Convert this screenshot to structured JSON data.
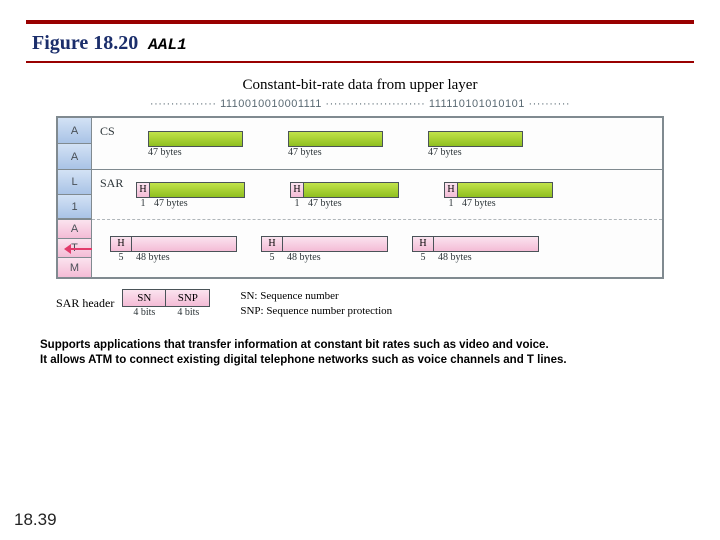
{
  "title": {
    "number": "Figure 18.20",
    "name": "AAL1"
  },
  "upper": {
    "heading": "Constant-bit-rate data from upper layer",
    "bits": "················ 1110010010001111 ························ 111110101010101 ··········"
  },
  "sidebar": {
    "aal": [
      "A",
      "A",
      "L",
      "1"
    ],
    "atm": [
      "A",
      "T",
      "M"
    ]
  },
  "rows": {
    "cs": {
      "label": "CS",
      "unit_len": "47 bytes"
    },
    "sar": {
      "label": "SAR",
      "h": "H",
      "h_len": "1",
      "payload_len": "47 bytes"
    },
    "atm": {
      "h": "H",
      "h_len": "5",
      "payload_len": "48 bytes"
    }
  },
  "legend": {
    "sar_label": "SAR header",
    "sn": {
      "name": "SN",
      "bits": "4 bits",
      "desc": "SN: Sequence number"
    },
    "snp": {
      "name": "SNP",
      "bits": "4 bits",
      "desc": "SNP: Sequence number protection"
    }
  },
  "description": {
    "line1": "Supports applications that transfer information at constant bit rates such as video and voice.",
    "line2": "It allows ATM to connect existing digital telephone networks such as voice channels and T lines."
  },
  "page_number": "18.39"
}
